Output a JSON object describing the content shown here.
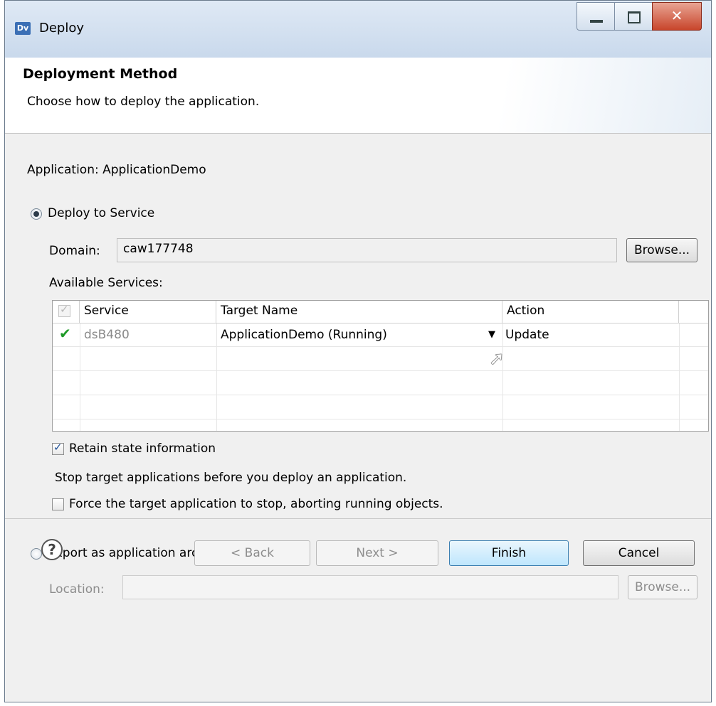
{
  "window": {
    "title": "Deploy",
    "icon_text": "Dv"
  },
  "header": {
    "title": "Deployment Method",
    "description": "Choose how to deploy the application."
  },
  "application_line": "Application: ApplicationDemo",
  "deploy_service": {
    "radio_label": "Deploy to Service",
    "selected": true,
    "domain_label": "Domain:",
    "domain_value": "caw177748",
    "browse_label": "Browse...",
    "services_label": "Available Services:",
    "columns": [
      "Service",
      "Target Name",
      "Action"
    ],
    "rows": [
      {
        "checked": true,
        "service": "dsB480",
        "target": "ApplicationDemo (Running)",
        "action": "Update"
      }
    ],
    "retain_state": {
      "label": "Retain state information",
      "checked": true
    },
    "stop_note": "Stop target applications before you deploy an application.",
    "force_stop": {
      "label": "Force the target application to stop, aborting running objects.",
      "checked": false
    }
  },
  "export_archive": {
    "radio_label": "Export as application archive file",
    "selected": false,
    "location_label": "Location:",
    "location_value": "",
    "browse_label": "Browse..."
  },
  "buttons": {
    "help": "?",
    "back": "< Back",
    "next": "Next >",
    "finish": "Finish",
    "cancel": "Cancel"
  }
}
